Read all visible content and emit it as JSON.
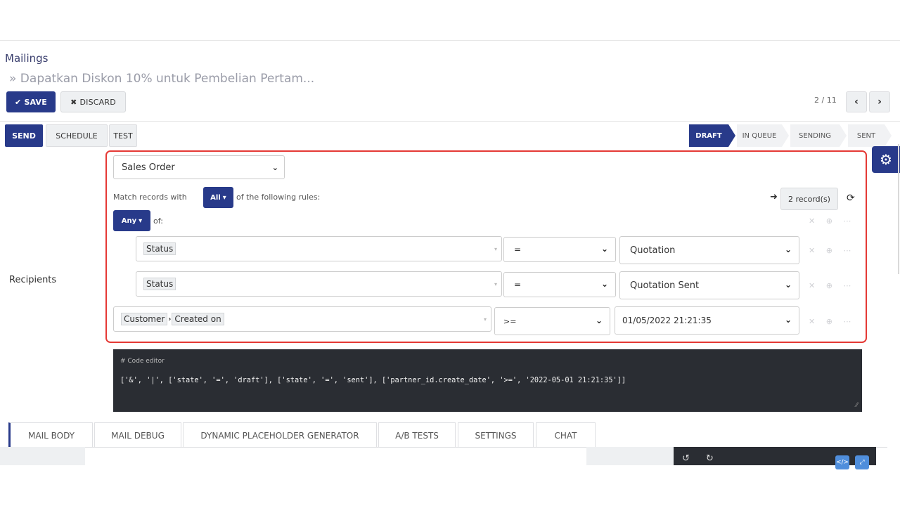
{
  "header": {
    "breadcrumb_parent": "Mailings",
    "breadcrumb_current": "» Dapatkan Diskon 10% untuk Pembelian Pertam..."
  },
  "toolbar": {
    "save_label": "SAVE",
    "discard_label": "DISCARD",
    "pager": "2 / 11",
    "prev_icon": "‹",
    "next_icon": "›"
  },
  "actions": {
    "send": "SEND",
    "schedule": "SCHEDULE",
    "test": "TEST"
  },
  "stages": [
    "DRAFT",
    "IN QUEUE",
    "SENDING",
    "SENT"
  ],
  "form": {
    "recipients_label": "Recipients",
    "model": "Sales Order",
    "match_prefix": "Match records with",
    "match_mode": "All",
    "match_suffix": "of the following rules:",
    "group_mode": "Any",
    "group_suffix": "of:",
    "record_count": "2 record(s)",
    "rules": [
      {
        "field": "Status",
        "operator": "=",
        "value": "Quotation"
      },
      {
        "field": "Status",
        "operator": "=",
        "value": "Quotation Sent"
      },
      {
        "field_path": [
          "Customer",
          "Created on"
        ],
        "operator": ">=",
        "value": "01/05/2022 21:21:35"
      }
    ]
  },
  "code_editor": {
    "header": "# Code editor",
    "code": "['&', '|', ['state', '=', 'draft'], ['state', '=', 'sent'], ['partner_id.create_date', '>=', '2022-05-01 21:21:35']]"
  },
  "tabs": [
    "MAIL BODY",
    "MAIL DEBUG",
    "DYNAMIC PLACEHOLDER GENERATOR",
    "A/B TESTS",
    "SETTINGS",
    "CHAT"
  ],
  "colors": {
    "primary": "#283a8a",
    "highlight": "#e53935",
    "editor_bg": "#2a2d33"
  }
}
